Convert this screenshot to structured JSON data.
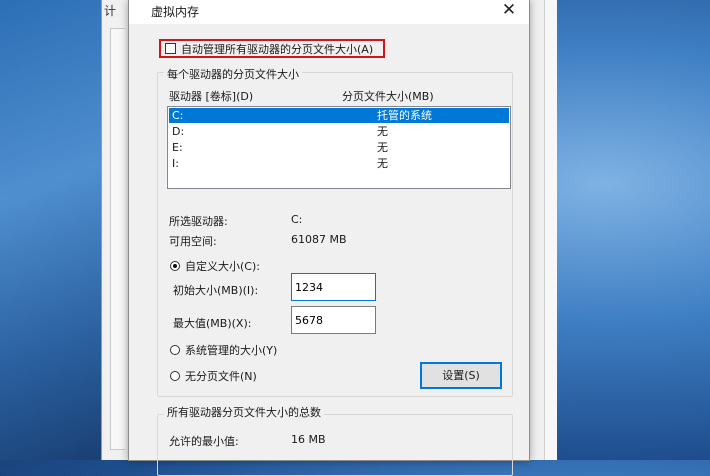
{
  "background_window": {
    "tab_fragment": "计"
  },
  "dialog": {
    "title": "虚拟内存",
    "close_glyph": "✕",
    "auto_manage": {
      "label": "自动管理所有驱动器的分页文件大小(A)",
      "checked": false
    },
    "per_drive_group_title": "每个驱动器的分页文件大小",
    "columns": {
      "drive": "驱动器 [卷标](D)",
      "size": "分页文件大小(MB)"
    },
    "drives": [
      {
        "drive": "C:",
        "size": "托管的系统",
        "selected": true
      },
      {
        "drive": "D:",
        "size": "无",
        "selected": false
      },
      {
        "drive": "E:",
        "size": "无",
        "selected": false
      },
      {
        "drive": "I:",
        "size": "无",
        "selected": false
      }
    ],
    "selected_drive_label": "所选驱动器:",
    "selected_drive_value": "C:",
    "free_space_label": "可用空间:",
    "free_space_value": "61087 MB",
    "custom_size": {
      "label": "自定义大小(C):",
      "selected": true
    },
    "initial_size": {
      "label": "初始大小(MB)(I):",
      "value": "1234"
    },
    "max_size": {
      "label": "最大值(MB)(X):",
      "value": "5678"
    },
    "system_managed": {
      "label": "系统管理的大小(Y)",
      "selected": false
    },
    "no_paging": {
      "label": "无分页文件(N)",
      "selected": false
    },
    "set_button": "设置(S)",
    "totals_group_title": "所有驱动器分页文件大小的总数",
    "min_allowed_label": "允许的最小值:",
    "min_allowed_value": "16 MB"
  },
  "colors": {
    "accent": "#0078d7",
    "highlight_border": "#d3151b"
  }
}
